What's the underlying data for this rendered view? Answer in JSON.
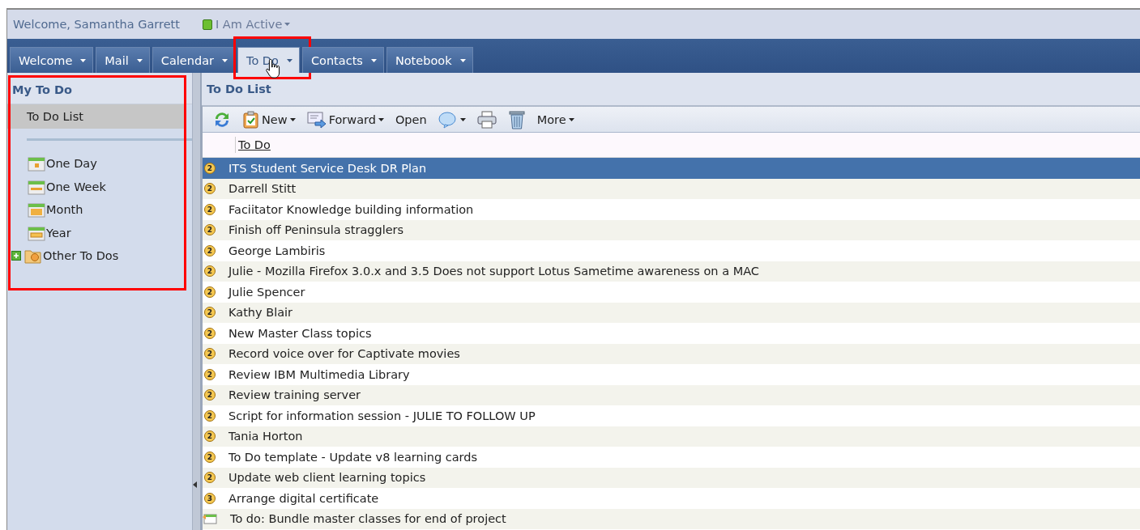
{
  "header": {
    "welcome": "Welcome, Samantha Garrett",
    "status": "I Am Active"
  },
  "tabs": [
    {
      "label": "Welcome",
      "selected": false,
      "highlighted": false
    },
    {
      "label": "Mail",
      "selected": false,
      "highlighted": false
    },
    {
      "label": "Calendar",
      "selected": false,
      "highlighted": false
    },
    {
      "label": "To Do",
      "selected": true,
      "highlighted": true
    },
    {
      "label": "Contacts",
      "selected": false,
      "highlighted": false
    },
    {
      "label": "Notebook",
      "selected": false,
      "highlighted": false
    }
  ],
  "sidebar": {
    "title": "My To Do",
    "highlighted": true,
    "items": [
      {
        "label": "To Do List",
        "kind": "plain",
        "selected": true
      },
      {
        "label": "One Day",
        "kind": "day",
        "selected": false
      },
      {
        "label": "One Week",
        "kind": "week",
        "selected": false
      },
      {
        "label": "Month",
        "kind": "month",
        "selected": false
      },
      {
        "label": "Year",
        "kind": "year",
        "selected": false
      },
      {
        "label": "Other To Dos",
        "kind": "folder",
        "selected": false,
        "expanded": false
      }
    ]
  },
  "main": {
    "title": "To Do List",
    "toolbar": [
      {
        "kind": "refresh"
      },
      {
        "kind": "new",
        "label": "New",
        "menu": true
      },
      {
        "kind": "forward",
        "label": "Forward",
        "menu": true
      },
      {
        "kind": "text",
        "label": "Open",
        "menu": false
      },
      {
        "kind": "chat",
        "menu": true
      },
      {
        "kind": "print"
      },
      {
        "kind": "trash"
      },
      {
        "kind": "text",
        "label": "More",
        "menu": true
      }
    ],
    "column": "To Do",
    "rows": [
      {
        "kind": "priority",
        "priority": "2",
        "title": "ITS Student Service Desk DR Plan",
        "selected": true
      },
      {
        "kind": "priority",
        "priority": "2",
        "title": "Darrell Stitt",
        "selected": false
      },
      {
        "kind": "priority",
        "priority": "2",
        "title": "Faciitator Knowledge building information",
        "selected": false
      },
      {
        "kind": "priority",
        "priority": "2",
        "title": "Finish off Peninsula stragglers",
        "selected": false
      },
      {
        "kind": "priority",
        "priority": "2",
        "title": "George Lambiris",
        "selected": false
      },
      {
        "kind": "priority",
        "priority": "2",
        "title": "Julie - Mozilla Firefox 3.0.x and 3.5 Does not support Lotus Sametime awareness on a MAC",
        "selected": false
      },
      {
        "kind": "priority",
        "priority": "2",
        "title": "Julie Spencer",
        "selected": false
      },
      {
        "kind": "priority",
        "priority": "2",
        "title": "Kathy Blair",
        "selected": false
      },
      {
        "kind": "priority",
        "priority": "2",
        "title": "New Master Class topics",
        "selected": false
      },
      {
        "kind": "priority",
        "priority": "2",
        "title": "Record voice over for Captivate movies",
        "selected": false
      },
      {
        "kind": "priority",
        "priority": "2",
        "title": "Review IBM Multimedia Library",
        "selected": false
      },
      {
        "kind": "priority",
        "priority": "2",
        "title": "Review training server",
        "selected": false
      },
      {
        "kind": "priority",
        "priority": "2",
        "title": "Script for information session - JULIE TO FOLLOW UP",
        "selected": false
      },
      {
        "kind": "priority",
        "priority": "2",
        "title": "Tania Horton",
        "selected": false
      },
      {
        "kind": "priority",
        "priority": "2",
        "title": "To Do template - Update v8 learning cards",
        "selected": false
      },
      {
        "kind": "priority",
        "priority": "2",
        "title": "Update web client learning topics",
        "selected": false
      },
      {
        "kind": "priority",
        "priority": "3",
        "title": "Arrange digital certificate",
        "selected": false
      },
      {
        "kind": "entry",
        "title": "To do: Bundle master classes for end of project",
        "selected": false
      }
    ]
  }
}
